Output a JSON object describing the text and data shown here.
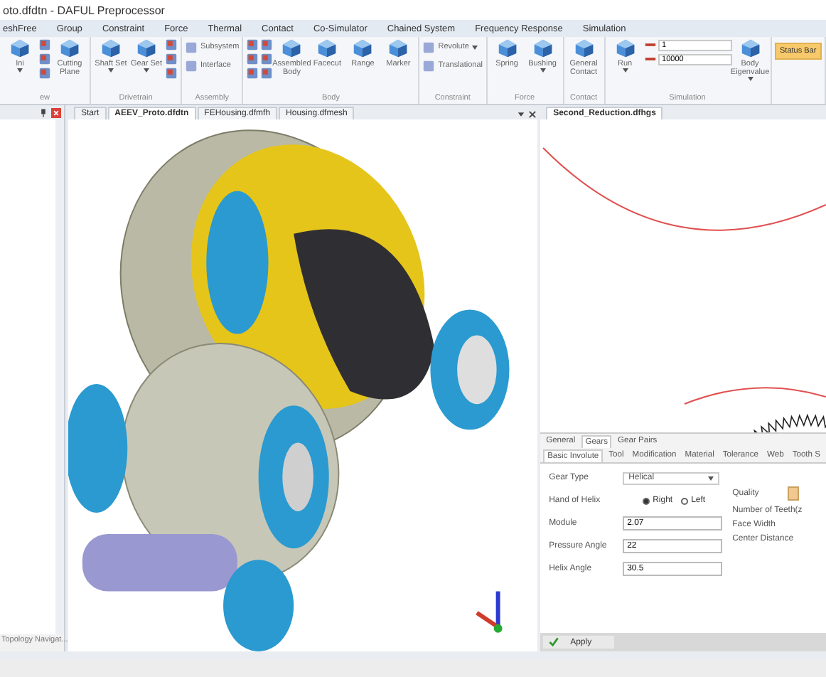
{
  "window": {
    "title": "oto.dfdtn - DAFUL Preprocessor"
  },
  "menu": [
    {
      "label": "eshFree",
      "selected": false
    },
    {
      "label": "Group",
      "selected": false
    },
    {
      "label": "Constraint",
      "selected": false
    },
    {
      "label": "Force",
      "selected": false
    },
    {
      "label": "Thermal",
      "selected": false
    },
    {
      "label": "Contact",
      "selected": false
    },
    {
      "label": "Co-Simulator",
      "selected": false
    },
    {
      "label": "Chained System",
      "selected": false
    },
    {
      "label": "Frequency Response",
      "selected": false
    },
    {
      "label": "Simulation",
      "selected": false
    }
  ],
  "ribbon": [
    {
      "label": "ew",
      "items": [
        {
          "kind": "large",
          "label": "Ini",
          "dropdown": true
        },
        {
          "kind": "stack"
        },
        {
          "kind": "large",
          "label": "Cutting Plane",
          "dropdown": false
        }
      ]
    },
    {
      "label": "Drivetrain",
      "items": [
        {
          "kind": "large",
          "label": "Shaft Set",
          "dropdown": true
        },
        {
          "kind": "large",
          "label": "Gear Set",
          "dropdown": true
        },
        {
          "kind": "stack"
        }
      ]
    },
    {
      "label": "Assembly",
      "items": [
        {
          "kind": "small",
          "label": "Subsystem",
          "dropdown": false
        },
        {
          "kind": "small",
          "label": "Interface",
          "dropdown": false
        }
      ]
    },
    {
      "label": "Body",
      "items": [
        {
          "kind": "stack"
        },
        {
          "kind": "stack"
        },
        {
          "kind": "large",
          "label": "Assembled Body",
          "dropdown": false
        },
        {
          "kind": "large",
          "label": "Facecut",
          "dropdown": false
        },
        {
          "kind": "large",
          "label": "Range",
          "dropdown": false
        },
        {
          "kind": "large",
          "label": "Marker",
          "dropdown": false
        }
      ]
    },
    {
      "label": "Constraint",
      "items": [
        {
          "kind": "small",
          "label": "Revolute",
          "dropdown": true
        },
        {
          "kind": "small",
          "label": "Translational",
          "dropdown": false
        }
      ]
    },
    {
      "label": "Force",
      "items": [
        {
          "kind": "large",
          "label": "Spring",
          "dropdown": false
        },
        {
          "kind": "large",
          "label": "Bushing",
          "dropdown": true
        }
      ]
    },
    {
      "label": "Contact",
      "items": [
        {
          "kind": "large",
          "label": "General Contact",
          "dropdown": false
        }
      ]
    },
    {
      "label": "Simulation",
      "items": [
        {
          "kind": "large",
          "label": "Run",
          "dropdown": true
        },
        {
          "kind": "fields",
          "values": [
            "1",
            "10000"
          ]
        },
        {
          "kind": "large",
          "label": "Body Eigenvalue",
          "dropdown": true
        }
      ]
    },
    {
      "items": [
        {
          "kind": "toggle",
          "label": "Status Bar",
          "checked": true
        }
      ]
    }
  ],
  "left_panel": {
    "tab": "Topology Navigat..."
  },
  "doc_tabs": [
    {
      "label": "Start",
      "selected": false
    },
    {
      "label": "AEEV_Proto.dfdtn",
      "selected": true
    },
    {
      "label": "FEHousing.dfmfh",
      "selected": false
    },
    {
      "label": "Housing.dfmesh",
      "selected": false
    }
  ],
  "right_tabs": [
    {
      "label": "Second_Reduction.dfhgs",
      "selected": true
    }
  ],
  "properties": {
    "tabs": [
      {
        "label": "General",
        "selected": false
      },
      {
        "label": "Gears",
        "selected": true
      },
      {
        "label": "Gear Pairs",
        "selected": false
      }
    ],
    "subtabs": [
      {
        "label": "Basic Involute",
        "selected": true
      },
      {
        "label": "Tool",
        "selected": false
      },
      {
        "label": "Modification",
        "selected": false
      },
      {
        "label": "Material",
        "selected": false
      },
      {
        "label": "Tolerance",
        "selected": false
      },
      {
        "label": "Web",
        "selected": false
      },
      {
        "label": "Tooth S",
        "selected": false
      }
    ],
    "gear_type": {
      "label": "Gear Type",
      "value": "Helical"
    },
    "hand_of_helix": {
      "label": "Hand of Helix",
      "options": [
        {
          "label": "Right",
          "selected": true
        },
        {
          "label": "Left",
          "selected": false
        }
      ]
    },
    "fields": [
      {
        "label": "Module",
        "value": "2.07"
      },
      {
        "label": "Pressure Angle",
        "value": "22"
      },
      {
        "label": "Helix Angle",
        "value": "30.5"
      }
    ],
    "right_labels": [
      "Quality",
      "Number of Teeth(z",
      "Face Width",
      "Center Distance"
    ],
    "apply": "Apply"
  }
}
